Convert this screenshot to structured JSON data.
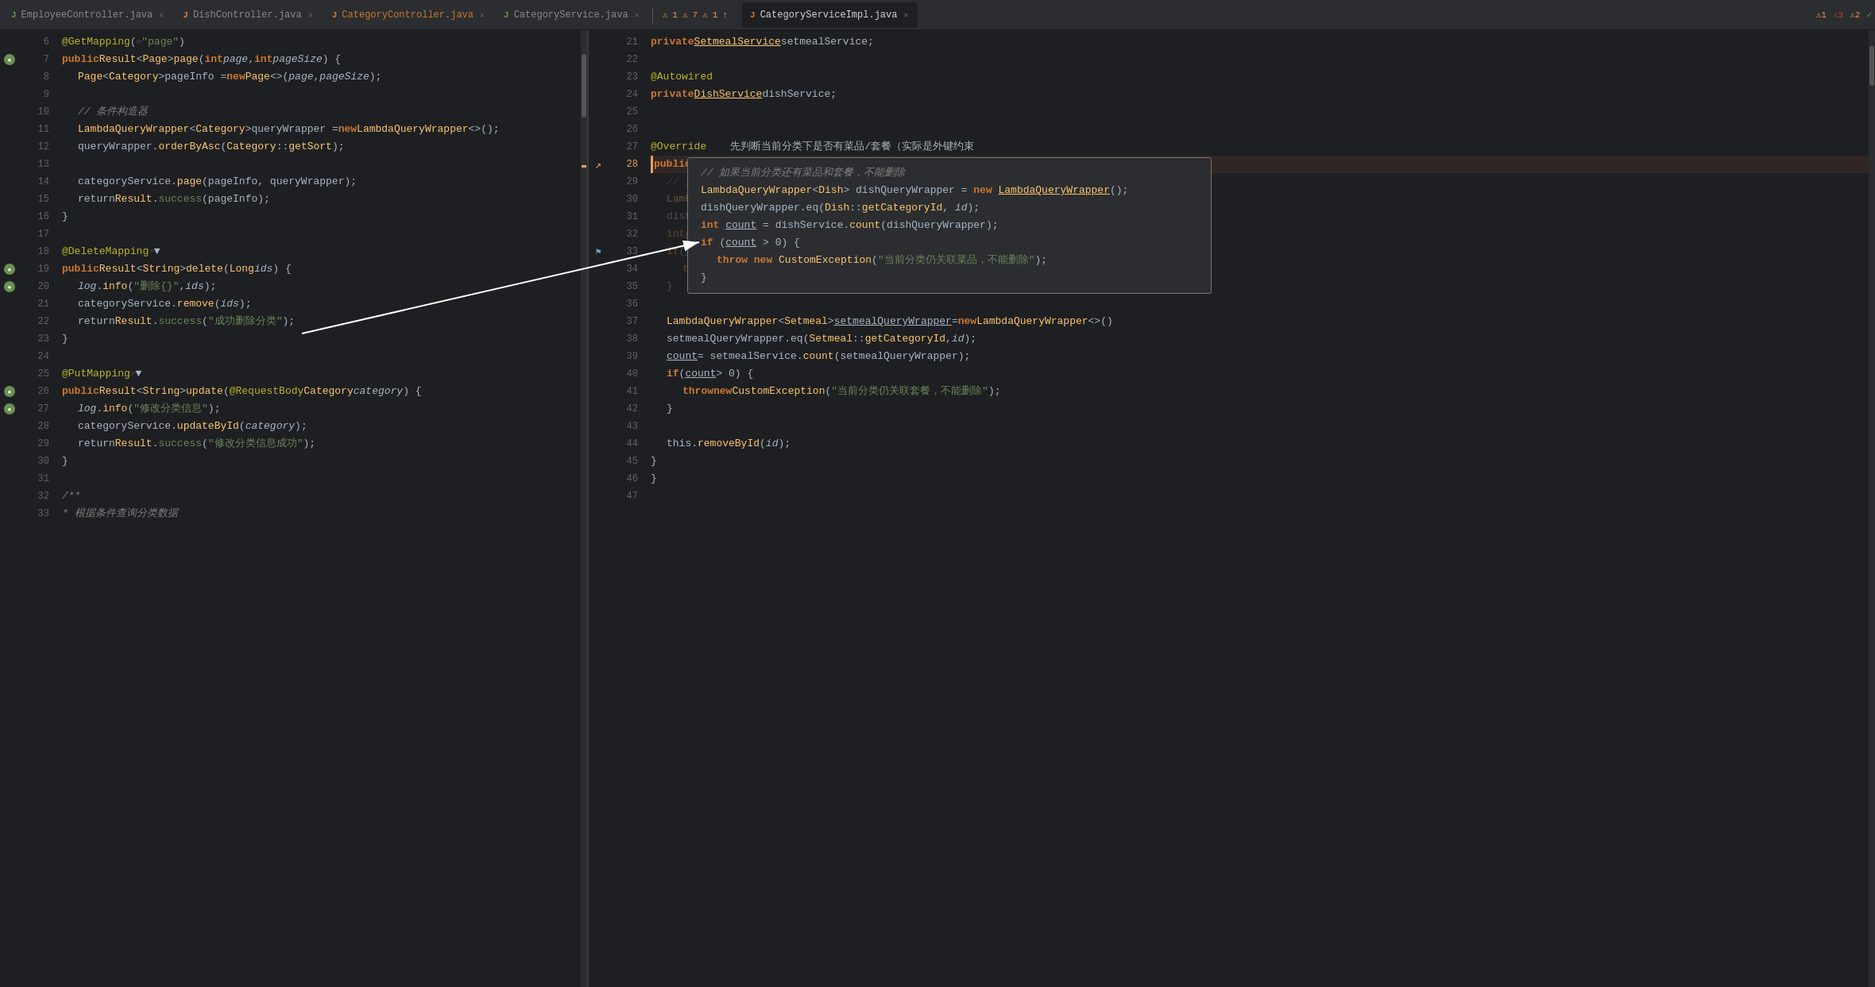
{
  "tabs": [
    {
      "label": "EmployeeController.java",
      "active": false,
      "modified": false,
      "icon": "java-green",
      "id": "tab-employee"
    },
    {
      "label": "DishController.java",
      "active": false,
      "modified": false,
      "icon": "java",
      "id": "tab-dish"
    },
    {
      "label": "CategoryController.java",
      "active": false,
      "modified": true,
      "icon": "java-pink",
      "id": "tab-category"
    },
    {
      "label": "CategoryService.java",
      "active": false,
      "modified": false,
      "icon": "java",
      "id": "tab-categoryservice"
    },
    {
      "label": "CategoryServiceImpl.java",
      "active": true,
      "modified": false,
      "icon": "java-pink",
      "id": "tab-categoryserviceimpl"
    }
  ],
  "left_warnings": "⚠1 ⚠7 ⚠1 ↑",
  "right_warnings": "⚠1 ⚠3 ⚠2 ✓",
  "left_lines": [
    {
      "num": 6,
      "gutter": "bean",
      "code": "@GetMapping(☞\"page\")"
    },
    {
      "num": 7,
      "gutter": "",
      "code": "public Result<Page> page(int page, int pageSize) {"
    },
    {
      "num": 8,
      "gutter": "",
      "code": "    Page<Category> pageInfo = new Page<>(page, pageSize);"
    },
    {
      "num": 9,
      "gutter": "",
      "code": ""
    },
    {
      "num": 10,
      "gutter": "",
      "code": "    // 条件构造器"
    },
    {
      "num": 11,
      "gutter": "",
      "code": "    LambdaQueryWrapper<Category> queryWrapper = new LambdaQueryWrapper<>();"
    },
    {
      "num": 12,
      "gutter": "",
      "code": "    queryWrapper.orderByAsc(Category::getSort);"
    },
    {
      "num": 13,
      "gutter": "",
      "code": ""
    },
    {
      "num": 14,
      "gutter": "",
      "code": "    categoryService.page(pageInfo, queryWrapper);"
    },
    {
      "num": 15,
      "gutter": "",
      "code": "    return Result.success(pageInfo);"
    },
    {
      "num": 16,
      "gutter": "",
      "code": "}"
    },
    {
      "num": 17,
      "gutter": "",
      "code": ""
    },
    {
      "num": 18,
      "gutter": "bean",
      "code": "@DeleteMapping☞▼"
    },
    {
      "num": 19,
      "gutter": "bean",
      "code": "public Result<String> delete(Long ids) {"
    },
    {
      "num": 20,
      "gutter": "",
      "code": "    log.info(\"删除{}\", ids);"
    },
    {
      "num": 21,
      "gutter": "",
      "code": "    categoryService.remove(ids);"
    },
    {
      "num": 22,
      "gutter": "",
      "code": "    return Result.success(\"成功删除分类\");"
    },
    {
      "num": 23,
      "gutter": "",
      "code": "}"
    },
    {
      "num": 24,
      "gutter": "",
      "code": ""
    },
    {
      "num": 25,
      "gutter": "bean",
      "code": "@PutMapping☞▼"
    },
    {
      "num": 26,
      "gutter": "bean",
      "code": "public Result<String> update(@RequestBody Category category) {"
    },
    {
      "num": 27,
      "gutter": "",
      "code": "    log.info(\"修改分类信息\");"
    },
    {
      "num": 28,
      "gutter": "",
      "code": "    categoryService.updateById(category);"
    },
    {
      "num": 29,
      "gutter": "",
      "code": "    return Result.success(\"修改分类信息成功\");"
    },
    {
      "num": 30,
      "gutter": "",
      "code": "}"
    },
    {
      "num": 31,
      "gutter": "",
      "code": ""
    },
    {
      "num": 32,
      "gutter": "",
      "code": "/**"
    },
    {
      "num": 33,
      "gutter": "",
      "code": " * 根据条件查询分类数据"
    }
  ],
  "right_lines": [
    {
      "num": 21,
      "gutter": "bookmark",
      "code": "private SetmealService setmealService;"
    },
    {
      "num": 22,
      "gutter": "",
      "code": ""
    },
    {
      "num": 23,
      "gutter": "",
      "code": "@Autowired"
    },
    {
      "num": 24,
      "gutter": "bookmark",
      "code": "private DishService dishService;"
    },
    {
      "num": 25,
      "gutter": "",
      "code": ""
    },
    {
      "num": 26,
      "gutter": "",
      "code": ""
    },
    {
      "num": 27,
      "gutter": "",
      "code": "@Override    先判断当前分类下是否有菜品/套餐（实际是外键约束"
    },
    {
      "num": 28,
      "gutter": "arrow",
      "code": "public void remove(Long id) {"
    },
    {
      "num": 29,
      "gutter": "",
      "code": ""
    },
    {
      "num": 30,
      "gutter": "",
      "code": ""
    },
    {
      "num": 31,
      "gutter": "",
      "code": ""
    },
    {
      "num": 32,
      "gutter": "",
      "code": ""
    },
    {
      "num": 33,
      "gutter": "",
      "code": ""
    },
    {
      "num": 34,
      "gutter": "",
      "code": ""
    },
    {
      "num": 35,
      "gutter": "",
      "code": ""
    },
    {
      "num": 36,
      "gutter": "",
      "code": ""
    },
    {
      "num": 37,
      "gutter": "",
      "code": "LambdaQueryWrapper<Setmeal> setmealQueryWrapper = new LambdaQueryWrapper<>();"
    },
    {
      "num": 38,
      "gutter": "",
      "code": "setmealQueryWrapper.eq(Setmeal::getCategoryId, id);"
    },
    {
      "num": 39,
      "gutter": "",
      "code": "count = setmealService.count(setmealQueryWrapper);"
    },
    {
      "num": 40,
      "gutter": "",
      "code": "if (count > 0) {"
    },
    {
      "num": 41,
      "gutter": "",
      "code": "    throw new CustomException(\"当前分类仍关联套餐，不能删除\");"
    },
    {
      "num": 42,
      "gutter": "",
      "code": "}"
    },
    {
      "num": 43,
      "gutter": "",
      "code": ""
    },
    {
      "num": 44,
      "gutter": "",
      "code": "this.removeById(id);"
    },
    {
      "num": 45,
      "gutter": "",
      "code": "}"
    },
    {
      "num": 46,
      "gutter": "",
      "code": "}"
    },
    {
      "num": 47,
      "gutter": "",
      "code": ""
    }
  ],
  "popup": {
    "lines": [
      "// 如果当前分类还有菜品和套餐，不能删除",
      "LambdaQueryWrapper<Dish> dishQueryWrapper = new LambdaQueryWrapper();",
      "dishQueryWrapper.eq(Dish::getCategoryId, id);",
      "int count = dishService.count(dishQueryWrapper);",
      "if (count > 0) {",
      "    throw new CustomException(\"当前分类仍关联菜品，不能删除\");",
      "}"
    ]
  }
}
